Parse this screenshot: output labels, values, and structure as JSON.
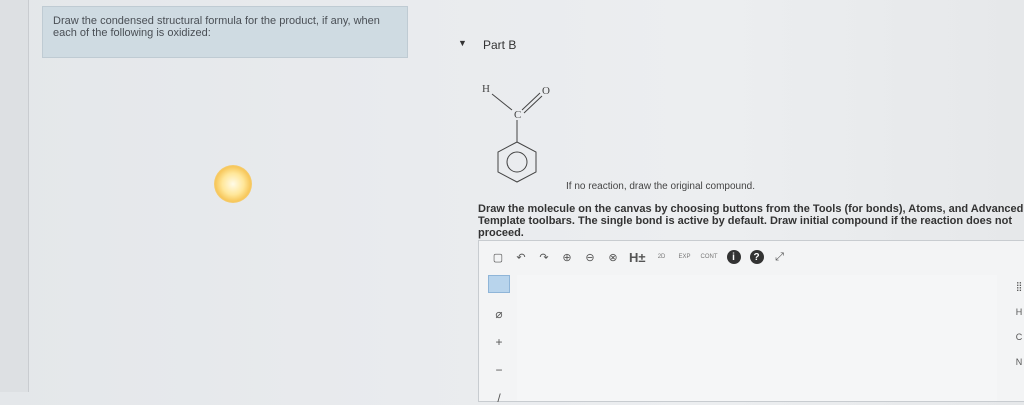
{
  "prompt": {
    "text": "Draw the condensed structural formula for the product, if any, when each of the following is oxidized:"
  },
  "part": {
    "toggle_icon": "triangle-down-icon",
    "label": "Part B"
  },
  "molecule": {
    "atom_h": "H",
    "atom_c": "C",
    "atom_o": "O"
  },
  "no_reaction_text": "If no reaction, draw the original compound.",
  "instructions": "Draw the molecule on the canvas by choosing buttons from the Tools (for bonds), Atoms, and Advanced Template toolbars. The single bond is active by default. Draw initial compound if the reaction does not proceed.",
  "toolbar": {
    "undo": "↶",
    "redo": "↷",
    "zoom_in": "⊕",
    "zoom_out": "⊖",
    "clear": "⊗",
    "h_toggle": "H±",
    "two_d": "2D",
    "exp": "EXP",
    "cont": "CONT",
    "info": "i",
    "help": "?",
    "expand": "⤢"
  },
  "left_tools": {
    "eraser": "⌀",
    "plus": "+",
    "minus": "−",
    "bond": "/"
  },
  "atoms": {
    "periodic": "⣿",
    "h": "H",
    "c": "C",
    "n": "N"
  }
}
